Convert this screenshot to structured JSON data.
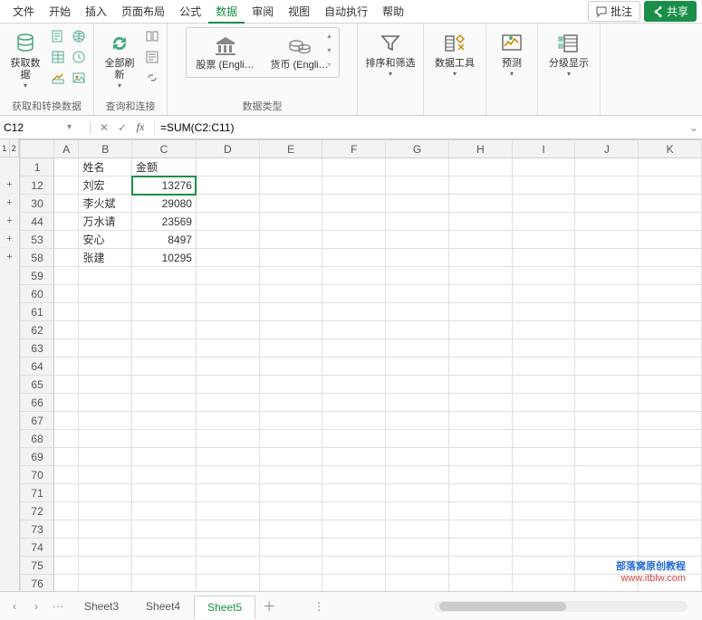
{
  "menu": {
    "items": [
      "文件",
      "开始",
      "插入",
      "页面布局",
      "公式",
      "数据",
      "审阅",
      "视图",
      "自动执行",
      "帮助"
    ],
    "active_index": 5,
    "annotate": "批注",
    "share": "共享"
  },
  "ribbon": {
    "groups": [
      {
        "key": "get_transform",
        "label": "获取和转换数据",
        "big": "获取数\n据",
        "big2": ""
      },
      {
        "key": "query_conn",
        "label": "查询和连接",
        "big": "全部刷新"
      },
      {
        "key": "data_types",
        "label": "数据类型",
        "types": [
          "股票 (Engli…",
          "货币 (Engli…"
        ]
      },
      {
        "key": "sort_filter",
        "label": "",
        "big": "排序和筛选"
      },
      {
        "key": "data_tools",
        "label": "",
        "big": "数据工具"
      },
      {
        "key": "forecast",
        "label": "",
        "big": "预测"
      },
      {
        "key": "outline",
        "label": "",
        "big": "分级显示"
      }
    ]
  },
  "namebox": {
    "value": "C12"
  },
  "formula": {
    "value": "=SUM(C2:C11)"
  },
  "outline": {
    "levels": [
      "1",
      "2"
    ],
    "buttons": [
      "+",
      "+",
      "+",
      "+",
      "+"
    ]
  },
  "columns": [
    "A",
    "B",
    "C",
    "D",
    "E",
    "F",
    "G",
    "H",
    "I",
    "J",
    "K"
  ],
  "rows": [
    {
      "n": 1,
      "cells": {
        "B": "姓名",
        "C": "金额"
      }
    },
    {
      "n": 12,
      "cells": {
        "B": "刘宏",
        "C": "13276"
      },
      "selected": "C"
    },
    {
      "n": 30,
      "cells": {
        "B": "李火斌",
        "C": "29080"
      }
    },
    {
      "n": 44,
      "cells": {
        "B": "万水请",
        "C": "23569"
      }
    },
    {
      "n": 53,
      "cells": {
        "B": "安心",
        "C": "8497"
      }
    },
    {
      "n": 58,
      "cells": {
        "B": "张建",
        "C": "10295"
      }
    },
    {
      "n": 59,
      "cells": {}
    },
    {
      "n": 60,
      "cells": {}
    },
    {
      "n": 61,
      "cells": {}
    },
    {
      "n": 62,
      "cells": {}
    },
    {
      "n": 63,
      "cells": {}
    },
    {
      "n": 64,
      "cells": {}
    },
    {
      "n": 65,
      "cells": {}
    },
    {
      "n": 66,
      "cells": {}
    },
    {
      "n": 67,
      "cells": {}
    },
    {
      "n": 68,
      "cells": {}
    },
    {
      "n": 69,
      "cells": {}
    },
    {
      "n": 70,
      "cells": {}
    },
    {
      "n": 71,
      "cells": {}
    },
    {
      "n": 72,
      "cells": {}
    },
    {
      "n": 73,
      "cells": {}
    },
    {
      "n": 74,
      "cells": {}
    },
    {
      "n": 75,
      "cells": {}
    },
    {
      "n": 76,
      "cells": {}
    }
  ],
  "watermark": {
    "line1": "部落窝原创教程",
    "line2": "www.itblw.com"
  },
  "tabs": {
    "items": [
      "Sheet3",
      "Sheet4",
      "Sheet5"
    ],
    "active_index": 2
  }
}
